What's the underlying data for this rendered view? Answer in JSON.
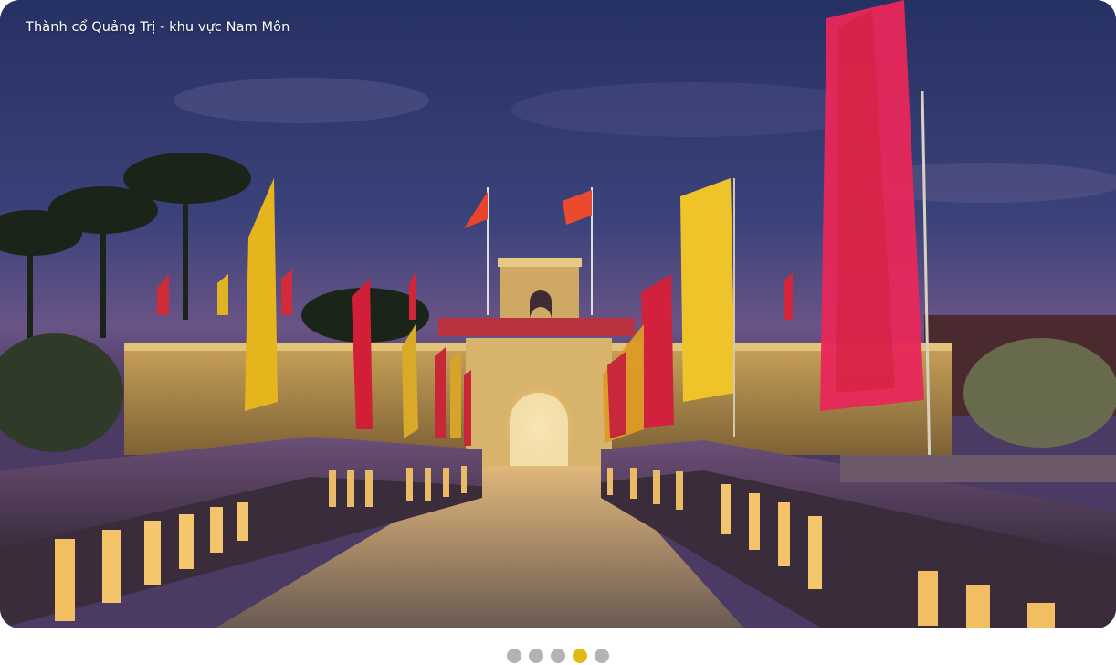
{
  "slide": {
    "caption": "Thành cổ Quảng Trị - khu vực Nam Môn"
  },
  "pagination": {
    "count": 5,
    "active_index": 3,
    "active_color": "#e2b816",
    "inactive_color": "#b3b3b3"
  }
}
